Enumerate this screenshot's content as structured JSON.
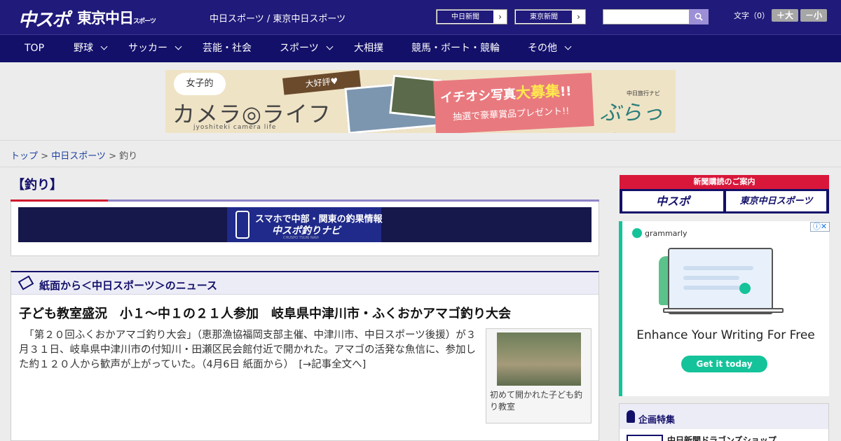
{
  "header": {
    "logo_chuspo": "中スポ",
    "logo_tokyo": "東京中日",
    "logo_tokyo_suffix": "スポーツ",
    "site_names": "中日スポーツ / 東京中日スポーツ",
    "paper_links": [
      {
        "label": "中日新聞",
        "arrow": "›"
      },
      {
        "label": "東京新聞",
        "arrow": "›"
      }
    ],
    "search": {
      "placeholder": ""
    },
    "font_label": "文字（0）",
    "font_buttons": [
      {
        "label": "＋大"
      },
      {
        "label": "－小"
      }
    ]
  },
  "nav": {
    "items": [
      {
        "label": "TOP",
        "has_menu": false
      },
      {
        "label": "野球",
        "has_menu": true
      },
      {
        "label": "サッカー",
        "has_menu": true
      },
      {
        "label": "芸能・社会",
        "has_menu": false
      },
      {
        "label": "スポーツ",
        "has_menu": true
      },
      {
        "label": "大相撲",
        "has_menu": false
      },
      {
        "label": "競馬・ボート・競輪",
        "has_menu": false
      },
      {
        "label": "その他",
        "has_menu": true
      }
    ]
  },
  "banner": {
    "joshi": "女子的",
    "camera_life": "カメラ◎ライフ",
    "romaji": "jyoshiteki camera life",
    "daikouhyo": "大好評♥",
    "ichioshi_pre": "イチオシ写真",
    "ichioshi_big": "大募集",
    "ichioshi_post": "!!",
    "chusen": "抽選で豪華賞品プレゼント!!",
    "navi": "中日旅行ナビ",
    "burattoh": "ぶらっ人"
  },
  "breadcrumb": {
    "items": [
      "トップ",
      "中日スポーツ"
    ],
    "current": "釣り",
    "separator": " > "
  },
  "page": {
    "heading": "【釣り】",
    "tsuri_banner": {
      "line1": "スマホで中部・関東の釣果情報",
      "line2": "中スポ釣りナビ",
      "line3": "CHUSPO TSURI NAVI"
    }
  },
  "news": {
    "section_label": "紙面から＜中日スポーツ＞のニュース",
    "article": {
      "title": "子ども教室盛況　小１～中１の２１人参加　岐阜県中津川市・ふくおかアマゴ釣り大会",
      "body": "　「第２０回ふくおかアマゴ釣り大会」（恵那漁協福岡支部主催、中津川市、中日スポーツ後援）が３月３１日、岐阜県中津川市の付知川・田瀬区民会館付近で開かれた。アマゴの活発な魚信に、参加した約１２０人から歓声が上がっていた。（4月6日 紙面から）　",
      "more": "[→記事全文へ]",
      "photo_caption": "初めて開かれた子ども釣り教室"
    }
  },
  "sidebar": {
    "subscribe_title": "新聞購読のご案内",
    "subscribe_buttons": [
      "中スポ",
      "東京中日スポーツ"
    ],
    "ad": {
      "brand": "grammarly",
      "headline": "Enhance Your Writing For Free",
      "cta": "Get it today",
      "info": "ⓘ✕"
    },
    "feature": {
      "label": "企画特集",
      "item": "中日新聞ドラゴンズショップ"
    }
  },
  "colors": {
    "brand_navy": "#201a7a",
    "nav_navy": "#13106a",
    "accent_red": "#d01a2d",
    "grammarly_green": "#15c39a"
  }
}
